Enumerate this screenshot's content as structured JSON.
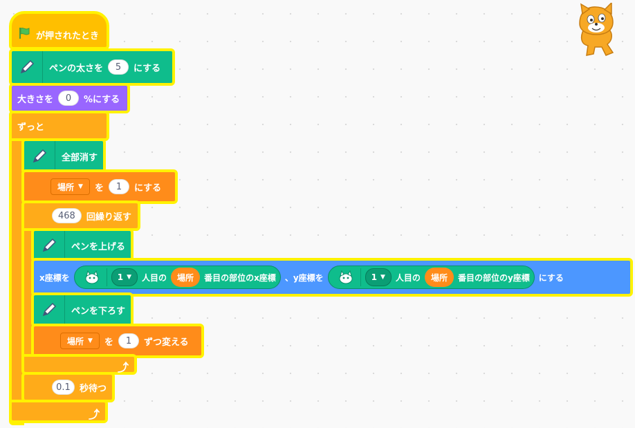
{
  "script": {
    "hat_label": "が押されたとき",
    "pen_size": {
      "prefix": "ペンの太さを",
      "value": "5",
      "suffix": "にする"
    },
    "set_size": {
      "prefix": "大きさを",
      "value": "0",
      "suffix": "%にする"
    },
    "forever_label": "ずっと",
    "clear_label": "全部消す",
    "set_var": {
      "var": "場所",
      "mid": "を",
      "value": "1",
      "suffix": "にする"
    },
    "repeat": {
      "value": "468",
      "label": "回繰り返す"
    },
    "pen_up_label": "ペンを上げる",
    "goto": {
      "x_label": "x座標を",
      "x_sprite_index": "1",
      "x_ninme": "人目の",
      "x_var": "場所",
      "x_part": "番目の部位のx座標",
      "sep": "、y座標を",
      "y_sprite_index": "1",
      "y_ninme": "人目の",
      "y_var": "場所",
      "y_part": "番目の部位のy座標",
      "suffix": "にする"
    },
    "pen_down_label": "ペンを下ろす",
    "change_var": {
      "var": "場所",
      "mid": "を",
      "value": "1",
      "suffix": "ずつ変える"
    },
    "wait": {
      "value": "0.1",
      "label": "秒待つ"
    }
  },
  "colors": {
    "highlight": "#fff200",
    "events": "#ffbf00",
    "control": "#ffab19",
    "pen": "#0fbd8c",
    "looks": "#9966ff",
    "motion": "#4c97ff",
    "data": "#ff8c1a"
  },
  "icons": [
    "green-flag-icon",
    "pen-icon",
    "sprite-thumbnail-icon",
    "loop-arrow-icon",
    "scratch-cat-icon"
  ]
}
